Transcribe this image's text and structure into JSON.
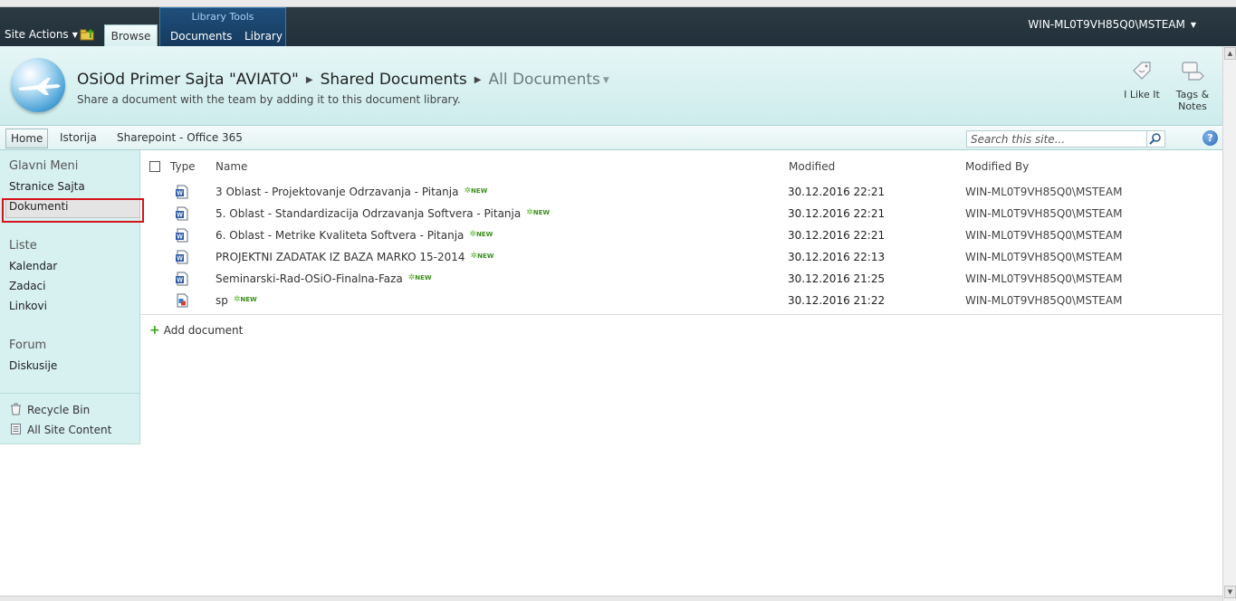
{
  "ribbon": {
    "site_actions_label": "Site Actions",
    "browse_tab": "Browse",
    "library_tools": {
      "title": "Library Tools",
      "documents_tab": "Documents",
      "library_tab": "Library"
    },
    "user_name": "WIN-ML0T9VH85Q0\\MSTEAM"
  },
  "title_area": {
    "site_title": "OSiOd Primer Sajta \"AVIATO\"",
    "library_name": "Shared Documents",
    "view_name": "All Documents",
    "description": "Share a document with the team by adding it to this document library.",
    "like_label": "I Like It",
    "tags_label_line1": "Tags &",
    "tags_label_line2": "Notes"
  },
  "topnav": {
    "items": [
      "Home",
      "Istorija",
      "Sharepoint - Office 365"
    ],
    "search_placeholder": "Search this site...",
    "help_glyph": "?"
  },
  "quicklaunch": {
    "heading_main": "Glavni Meni",
    "main_items": [
      "Stranice Sajta",
      "Dokumenti"
    ],
    "heading_lists": "Liste",
    "list_items": [
      "Kalendar",
      "Zadaci",
      "Linkovi"
    ],
    "heading_forum": "Forum",
    "forum_items": [
      "Diskusije"
    ],
    "recycle_bin": "Recycle Bin",
    "all_site_content": "All Site Content"
  },
  "doc_list": {
    "columns": {
      "type": "Type",
      "name": "Name",
      "modified": "Modified",
      "modified_by": "Modified By"
    },
    "new_badge": "NEW",
    "rows": [
      {
        "icon": "word-doc-icon",
        "name": "3 Oblast - Projektovanje Odrzavanja - Pitanja",
        "modified": "30.12.2016 22:21",
        "modified_by": "WIN-ML0T9VH85Q0\\MSTEAM"
      },
      {
        "icon": "word-doc-icon",
        "name": "5. Oblast - Standardizacija Odrzavanja Softvera - Pitanja",
        "modified": "30.12.2016 22:21",
        "modified_by": "WIN-ML0T9VH85Q0\\MSTEAM"
      },
      {
        "icon": "word-doc-icon",
        "name": "6. Oblast - Metrike Kvaliteta Softvera - Pitanja",
        "modified": "30.12.2016 22:21",
        "modified_by": "WIN-ML0T9VH85Q0\\MSTEAM"
      },
      {
        "icon": "word-doc-icon",
        "name": "PROJEKTNI ZADATAK IZ BAZA MARKO 15-2014",
        "modified": "30.12.2016 22:13",
        "modified_by": "WIN-ML0T9VH85Q0\\MSTEAM"
      },
      {
        "icon": "word-doc-icon",
        "name": "Seminarski-Rad-OSiO-Finalna-Faza",
        "modified": "30.12.2016 21:25",
        "modified_by": "WIN-ML0T9VH85Q0\\MSTEAM"
      },
      {
        "icon": "image-file-icon",
        "name": "sp",
        "modified": "30.12.2016 21:22",
        "modified_by": "WIN-ML0T9VH85Q0\\MSTEAM"
      }
    ],
    "add_document": "Add document"
  },
  "colors": {
    "ribbon_bg": "#2c3a43",
    "title_bg": "#d6f0f0",
    "quicklaunch_bg": "#d7f0f0",
    "highlight_box": "#d3141a",
    "new_badge": "#3a8e1c"
  }
}
